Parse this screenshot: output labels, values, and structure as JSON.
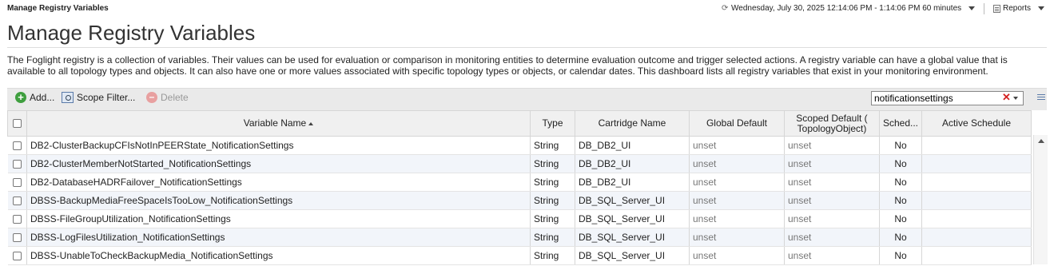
{
  "header": {
    "breadcrumb": "Manage Registry Variables",
    "time_range": "Wednesday, July 30, 2025 12:14:06 PM - 1:14:06 PM 60 minutes",
    "reports_label": "Reports"
  },
  "page": {
    "title": "Manage Registry Variables",
    "description": "The Foglight registry is a collection of variables. Their values can be used for evaluation or comparison in monitoring entities to determine evaluation outcome and trigger selected actions. A registry variable can have a global value that is available to all topology types and objects. It can also have one or more values associated with specific topology types or objects, or calendar dates. This dashboard lists all registry variables that exist in your monitoring environment."
  },
  "toolbar": {
    "add_label": "Add...",
    "scope_filter_label": "Scope Filter...",
    "delete_label": "Delete",
    "search_value": "notificationsettings"
  },
  "table": {
    "columns": {
      "variable_name": "Variable Name",
      "type": "Type",
      "cartridge_name": "Cartridge Name",
      "global_default": "Global Default",
      "scoped_default": "Scoped Default ( TopologyObject)",
      "scheduled": "Sched...",
      "active_schedule": "Active Schedule"
    },
    "rows": [
      {
        "name": "DB2-ClusterBackupCFIsNotInPEERState_NotificationSettings",
        "type": "String",
        "cartridge": "DB_DB2_UI",
        "global": "unset",
        "scoped": "unset",
        "sched": "No",
        "active": ""
      },
      {
        "name": "DB2-ClusterMemberNotStarted_NotificationSettings",
        "type": "String",
        "cartridge": "DB_DB2_UI",
        "global": "unset",
        "scoped": "unset",
        "sched": "No",
        "active": ""
      },
      {
        "name": "DB2-DatabaseHADRFailover_NotificationSettings",
        "type": "String",
        "cartridge": "DB_DB2_UI",
        "global": "unset",
        "scoped": "unset",
        "sched": "No",
        "active": ""
      },
      {
        "name": "DBSS-BackupMediaFreeSpaceIsTooLow_NotificationSettings",
        "type": "String",
        "cartridge": "DB_SQL_Server_UI",
        "global": "unset",
        "scoped": "unset",
        "sched": "No",
        "active": ""
      },
      {
        "name": "DBSS-FileGroupUtilization_NotificationSettings",
        "type": "String",
        "cartridge": "DB_SQL_Server_UI",
        "global": "unset",
        "scoped": "unset",
        "sched": "No",
        "active": ""
      },
      {
        "name": "DBSS-LogFilesUtilization_NotificationSettings",
        "type": "String",
        "cartridge": "DB_SQL_Server_UI",
        "global": "unset",
        "scoped": "unset",
        "sched": "No",
        "active": ""
      },
      {
        "name": "DBSS-UnableToCheckBackupMedia_NotificationSettings",
        "type": "String",
        "cartridge": "DB_SQL_Server_UI",
        "global": "unset",
        "scoped": "unset",
        "sched": "No",
        "active": ""
      }
    ]
  }
}
